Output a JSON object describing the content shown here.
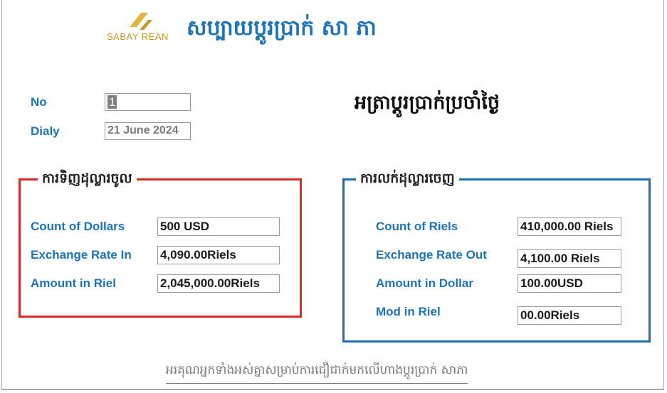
{
  "app": {
    "logo_text": "SABAY REAN",
    "title": "សប្បាយប្តូរប្រាក់ សា ភា"
  },
  "header": {
    "no_label": "No",
    "no_value": "1",
    "date_label": "Dialy",
    "date_value": "21 June 2024",
    "daily_rate_title": "អត្រាប្តូរប្រាក់ប្រចាំថ្ងៃ"
  },
  "buy_group": {
    "title": "ការទិញដុល្លារចូល",
    "rows": [
      {
        "label": "Count of Dollars",
        "value": "500 USD"
      },
      {
        "label": "Exchange Rate In",
        "value": "4,090.00Riels"
      },
      {
        "label": "Amount in Riel",
        "value": "2,045,000.00Riels"
      }
    ]
  },
  "sell_group": {
    "title": "ការលក់ដុល្លារចេញ",
    "rows": [
      {
        "label": "Count of Riels",
        "value": "410,000.00 Riels"
      },
      {
        "label": "Exchange Rate Out",
        "value": "4,100.00 Riels"
      },
      {
        "label": "Amount in Dollar",
        "value": "100.00USD"
      },
      {
        "label": "Mod in Riel",
        "value": "00.00Riels"
      }
    ]
  },
  "footer": {
    "text": "អរគុណអ្នកទាំងអស់គ្នាសម្រាប់ការជឿជាក់មកលើហាងប្តូរប្រាក់ សាភា"
  },
  "colors": {
    "brand_blue": "#1b73b8",
    "logo_gold": "#c6972b",
    "buy_border": "#d42a2a",
    "sell_border": "#1c6fb0"
  }
}
